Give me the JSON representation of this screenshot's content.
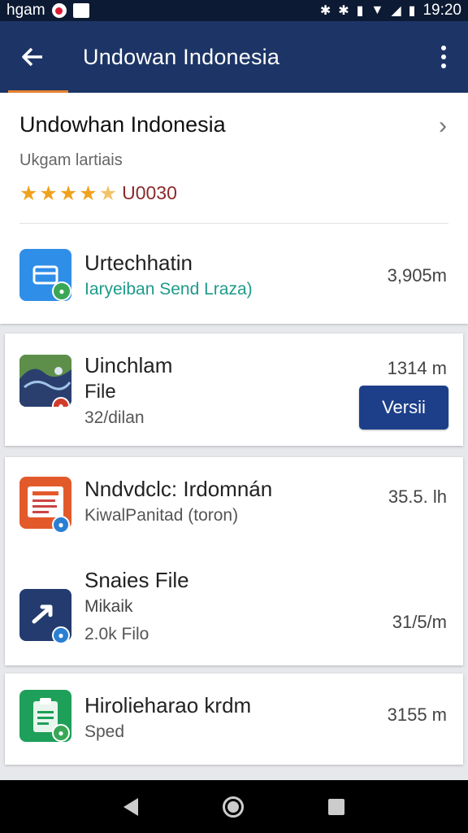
{
  "status_bar": {
    "left_text": "hgam",
    "time": "19:20"
  },
  "app_bar": {
    "title": "Undowan Indonesia"
  },
  "header": {
    "title": "Undowhan Indonesia",
    "subtitle": "Ukgam lartiais",
    "rating_text": "U0030",
    "rating_value": 4.5
  },
  "items": [
    {
      "title": "Urtechhatin",
      "subtitle": "Iaryeiban Send Lraza)",
      "size": "3,905m",
      "icon": "mail-box-icon",
      "icon_color": "#2f8ee8",
      "badge_color": "#3aa757"
    },
    {
      "title_line1": "Uinchlam",
      "title_line2": "File",
      "subtitle": "32/dilan",
      "size": "1314 m",
      "button": "Versii",
      "icon": "map-thumbnail-icon",
      "badge_color": "#d33b2c"
    },
    {
      "title": "Nndvdclc: Irdomnán",
      "subtitle": "KiwalPanitad (toron)",
      "size": "35.5. lh",
      "icon": "document-red-icon",
      "icon_color": "#e35a2a",
      "badge_color": "#2a7fd3"
    },
    {
      "title": "Snaies File",
      "subtitle_line1": "Mikaik",
      "subtitle_line2": "2.0k Filo",
      "size": "31/5/m",
      "icon": "share-arrow-icon",
      "icon_color": "#233b6e",
      "badge_color": "#2a7fd3"
    },
    {
      "title": "Hirolieharao krdm",
      "subtitle": "Sped",
      "size": "3155 m",
      "icon": "clipboard-icon",
      "icon_color": "#1e9f5a",
      "badge_color": "#3aa757"
    }
  ]
}
